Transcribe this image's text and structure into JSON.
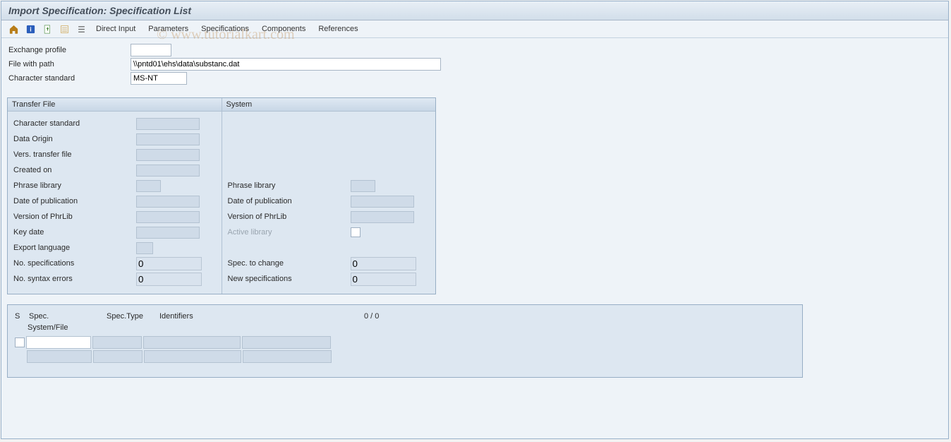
{
  "title": "Import Specification: Specification List",
  "toolbar": {
    "direct_input": "Direct Input",
    "parameters": "Parameters",
    "specifications": "Specifications",
    "components": "Components",
    "references": "References"
  },
  "top": {
    "exchange_profile_label": "Exchange profile",
    "exchange_profile_value": "",
    "file_with_path_label": "File with path",
    "file_with_path_value": "\\\\pntd01\\ehs\\data\\substanc.dat",
    "character_standard_label": "Character standard",
    "character_standard_value": "MS-NT"
  },
  "panels": {
    "transfer_file": {
      "header": "Transfer File",
      "character_standard": "Character standard",
      "data_origin": "Data Origin",
      "vers_transfer_file": "Vers. transfer file",
      "created_on": "Created on",
      "phrase_library": "Phrase library",
      "date_of_publication": "Date of publication",
      "version_of_phrlib": "Version of PhrLib",
      "key_date": "Key date",
      "export_language": "Export language",
      "no_specifications": "No. specifications",
      "no_specifications_value": "0",
      "no_syntax_errors": "No. syntax errors",
      "no_syntax_errors_value": "0"
    },
    "system": {
      "header": "System",
      "phrase_library": "Phrase library",
      "date_of_publication": "Date of publication",
      "version_of_phrlib": "Version of PhrLib",
      "active_library": "Active library",
      "spec_to_change": "Spec. to change",
      "spec_to_change_value": "0",
      "new_specifications": "New specifications",
      "new_specifications_value": "0"
    }
  },
  "list": {
    "col_s": "S",
    "col_spec": "Spec.",
    "col_spec_type": "Spec.Type",
    "col_identifiers": "Identifiers",
    "counter": "0  /  0",
    "col_system_file": "System/File"
  },
  "watermark": "© www.tutorialkart.com"
}
